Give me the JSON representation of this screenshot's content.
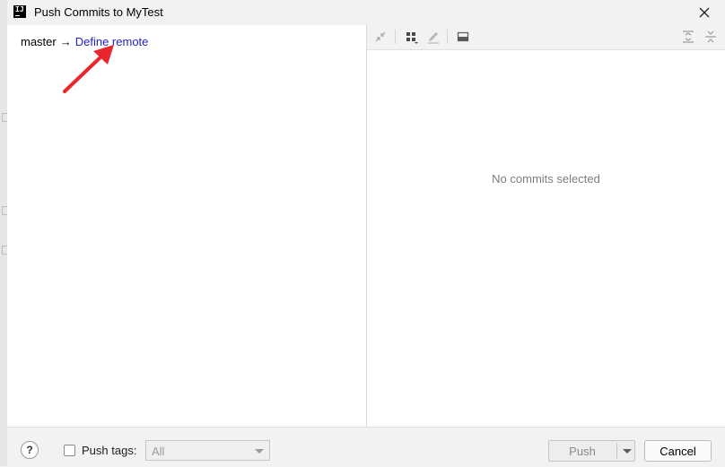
{
  "window": {
    "title": "Push Commits to MyTest"
  },
  "push_tree": {
    "branch": "master",
    "arrow": "→",
    "define_remote_label": "Define remote"
  },
  "details": {
    "empty_text": "No commits selected"
  },
  "footer": {
    "help_label": "?",
    "push_tags_label": "Push tags:",
    "tags_combo_value": "All",
    "push_label": "Push",
    "cancel_label": "Cancel"
  },
  "colors": {
    "link": "#2222c7",
    "annotation_arrow": "#e8262b"
  },
  "icons": [
    "app-logo-icon",
    "close-icon",
    "collapse-icon",
    "group-icon",
    "edit-icon",
    "preview-icon",
    "expand-all-icon",
    "collapse-all-icon",
    "checkbox-icon",
    "dropdown-arrow-icon"
  ]
}
